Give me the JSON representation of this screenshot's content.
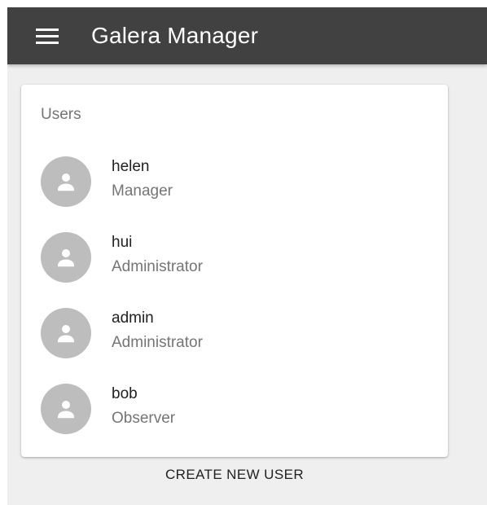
{
  "app_bar": {
    "menu_icon": "menu-icon",
    "title": "Galera Manager"
  },
  "users_card": {
    "title": "Users",
    "users": [
      {
        "name": "helen",
        "role": "Manager",
        "avatar_icon": "person-icon"
      },
      {
        "name": "hui",
        "role": "Administrator",
        "avatar_icon": "person-icon"
      },
      {
        "name": "admin",
        "role": "Administrator",
        "avatar_icon": "person-icon"
      },
      {
        "name": "bob",
        "role": "Observer",
        "avatar_icon": "person-icon"
      }
    ]
  },
  "actions": {
    "create_user_label": "CREATE NEW USER"
  },
  "colors": {
    "app_bar": "#414141",
    "page_background": "#efefef",
    "avatar_background": "#bdbdbd",
    "primary_text": "#212121",
    "secondary_text": "#757575"
  }
}
